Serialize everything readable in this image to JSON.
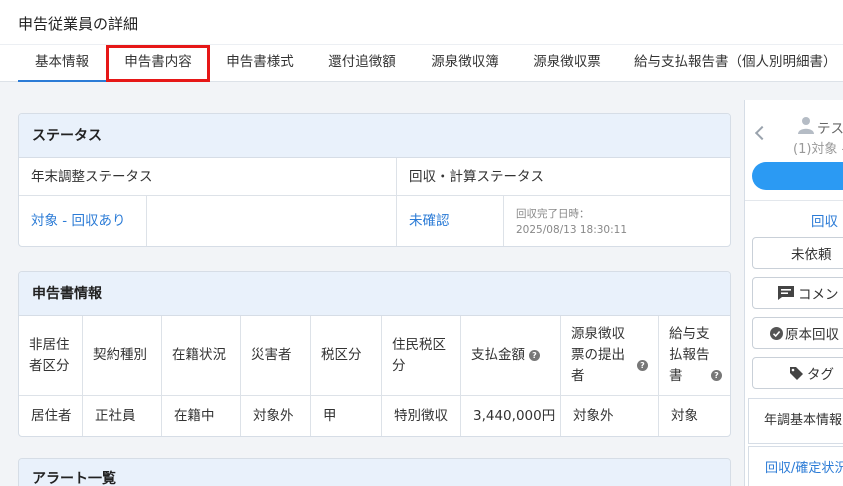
{
  "page_title": "申告従業員の詳細",
  "tabs": [
    {
      "label": "基本情報"
    },
    {
      "label": "申告書内容"
    },
    {
      "label": "申告書様式"
    },
    {
      "label": "還付追徴額"
    },
    {
      "label": "源泉徴収簿"
    },
    {
      "label": "源泉徴収票"
    },
    {
      "label": "給与支払報告書（個人別明細書）"
    }
  ],
  "status_card": {
    "title": "ステータス",
    "year_end_label": "年末調整ステータス",
    "collect_label": "回収・計算ステータス",
    "year_end_value": "対象 - 回収あり",
    "collect_value": "未確認",
    "complete_label": "回収完了日時：",
    "complete_datetime": "2025/08/13 18:30:11"
  },
  "info_card": {
    "title": "申告書情報",
    "headers": [
      "非居住者区分",
      "契約種別",
      "在籍状況",
      "災害者",
      "税区分",
      "住民税区分",
      "支払金額",
      "源泉徴収票の提出者",
      "給与支払報告書"
    ],
    "values": [
      "居住者",
      "正社員",
      "在籍中",
      "対象外",
      "甲",
      "特別徴収",
      "3,440,000円",
      "対象外",
      "対象"
    ]
  },
  "alert_card": {
    "title": "アラート一覧"
  },
  "right_panel": {
    "employee_name": "テス",
    "employee_sub": "(1)対象 -",
    "collect_link": "回収",
    "buttons": {
      "not_requested": "未依頼",
      "comment": "コメン",
      "original_collect": "原本回収",
      "tag": "タグ"
    },
    "sections": {
      "basic": "年調基本情報",
      "status": "回収/確定状況"
    }
  }
}
